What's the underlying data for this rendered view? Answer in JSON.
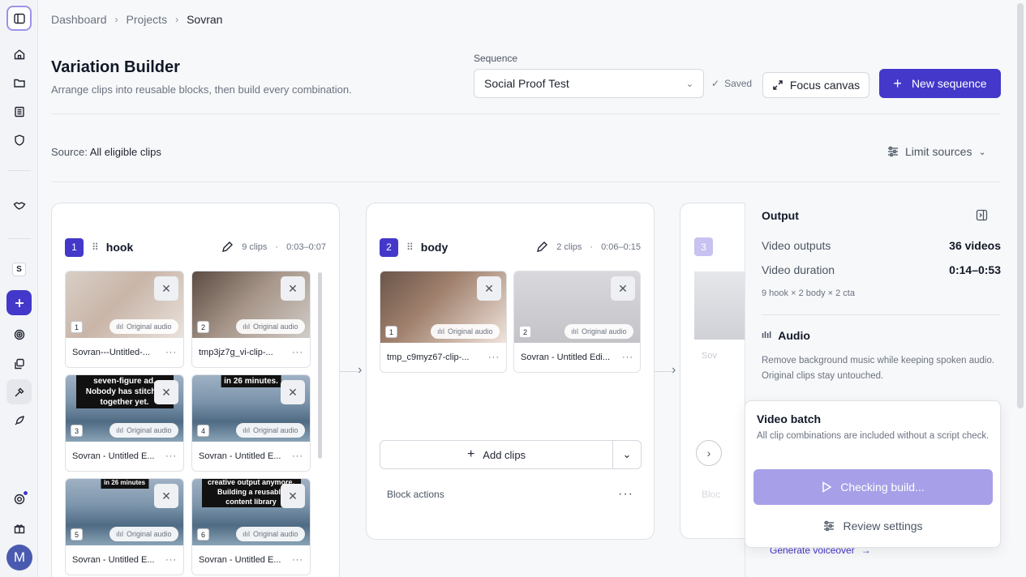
{
  "breadcrumb": [
    "Dashboard",
    "Projects",
    "Sovran"
  ],
  "page": {
    "title": "Variation Builder",
    "subtitle": "Arrange clips into reusable blocks, then build every combination."
  },
  "sequence": {
    "label": "Sequence",
    "value": "Social Proof Test",
    "saved": "Saved"
  },
  "actions": {
    "focus_canvas": "Focus canvas",
    "new_sequence": "New sequence"
  },
  "source": {
    "label": "Source:",
    "value": "All eligible clips",
    "limit": "Limit sources"
  },
  "sidebar": {
    "icons": [
      "panel-toggle-icon",
      "home-icon",
      "folder-icon",
      "library-icon",
      "shield-icon",
      "handshake-icon",
      "s-badge",
      "plus-icon",
      "target-icon",
      "copy-icon",
      "tools-icon",
      "rocket-icon",
      "support-icon",
      "gift-icon"
    ],
    "s_badge": "S",
    "avatar": "M",
    "accent": "#4338ca"
  },
  "blocks": [
    {
      "num": "1",
      "name": "hook",
      "clips_count": "9 clips",
      "duration": "0:03–0:07",
      "clips": [
        {
          "idx": "1",
          "audio": "Original audio",
          "name": "Sovran---Untitled-...",
          "caption": ""
        },
        {
          "idx": "2",
          "audio": "Original audio",
          "name": "tmp3jz7g_vi-clip-...",
          "caption": ""
        },
        {
          "idx": "3",
          "audio": "Original audio",
          "name": "Sovran - Untitled E...",
          "caption": "seven-figure ad. Nobody has stitch it together yet."
        },
        {
          "idx": "4",
          "audio": "Original audio",
          "name": "Sovran - Untitled E...",
          "caption": "in 26 minutes."
        },
        {
          "idx": "5",
          "audio": "Original audio",
          "name": "Sovran - Untitled E...",
          "caption": "in 26 minutes"
        },
        {
          "idx": "6",
          "audio": "Original audio",
          "name": "Sovran - Untitled E...",
          "caption": "creative output anymore. Building a reusable content library"
        }
      ]
    },
    {
      "num": "2",
      "name": "body",
      "clips_count": "2 clips",
      "duration": "0:06–0:15",
      "clips": [
        {
          "idx": "1",
          "audio": "Original audio",
          "name": "tmp_c9myz67-clip-..."
        },
        {
          "idx": "2",
          "audio": "Original audio",
          "name": "Sovran - Untitled Edi..."
        }
      ],
      "add_clips": "Add clips",
      "block_actions": "Block actions"
    },
    {
      "num": "3",
      "ghost_name": "Sov",
      "ghost_actions": "Bloc"
    }
  ],
  "output": {
    "title": "Output",
    "video_outputs_label": "Video outputs",
    "video_outputs_value": "36 videos",
    "video_duration_label": "Video duration",
    "video_duration_value": "0:14–0:53",
    "formula": "9 hook × 2 body × 2 cta",
    "audio_title": "Audio",
    "audio_desc": "Remove background music while keeping spoken audio. Original clips stay untouched.",
    "generate_voiceover": "Generate voiceover"
  },
  "batch": {
    "title": "Video batch",
    "desc": "All clip combinations are included without a script check.",
    "checking": "Checking build...",
    "review": "Review settings"
  }
}
